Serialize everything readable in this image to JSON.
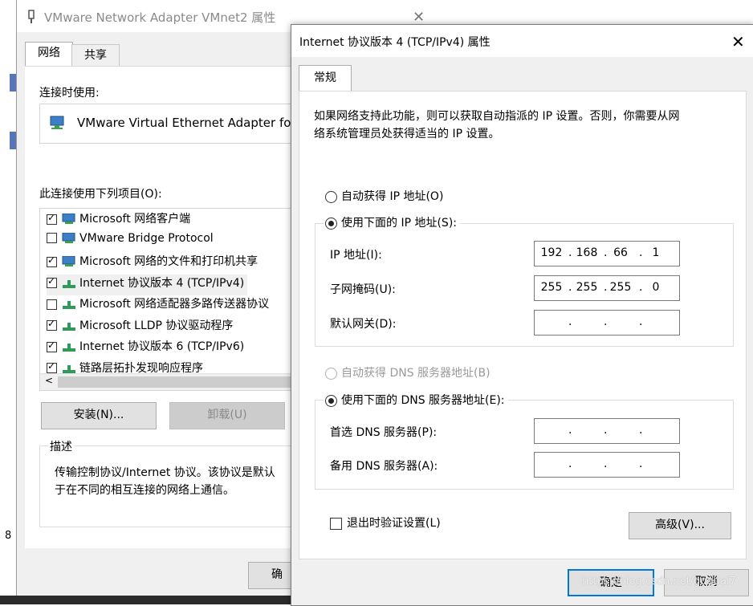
{
  "bg_window": {
    "title": "VMware Network Adapter VMnet2 属性",
    "tabs": [
      "网络",
      "共享"
    ],
    "connect_using_label": "连接时使用:",
    "adapter_name": "VMware Virtual Ethernet Adapter for",
    "items_label": "此连接使用下列项目(O):",
    "items": [
      {
        "label": "Microsoft 网络客户端",
        "checked": true,
        "icon": "network-client-icon"
      },
      {
        "label": "VMware Bridge Protocol",
        "checked": false,
        "icon": "network-client-icon"
      },
      {
        "label": "Microsoft 网络的文件和打印机共享",
        "checked": true,
        "icon": "network-client-icon"
      },
      {
        "label": "Internet 协议版本 4 (TCP/IPv4)",
        "checked": true,
        "icon": "protocol-icon"
      },
      {
        "label": "Microsoft 网络适配器多路传送器协议",
        "checked": false,
        "icon": "protocol-icon"
      },
      {
        "label": "Microsoft LLDP 协议驱动程序",
        "checked": true,
        "icon": "protocol-icon"
      },
      {
        "label": "Internet 协议版本 6 (TCP/IPv6)",
        "checked": true,
        "icon": "protocol-icon"
      },
      {
        "label": "链路层拓扑发现响应程序",
        "checked": true,
        "icon": "protocol-icon"
      }
    ],
    "install_button": "安装(N)...",
    "uninstall_button": "卸载(U)",
    "description_label": "描述",
    "description_text": "传输控制协议/Internet 协议。该协议是默认",
    "description_text2": "于在不同的相互连接的网络上通信。",
    "ok_button_partial": "确",
    "left_edge_char": "8"
  },
  "dialog": {
    "title": "Internet 协议版本 4 (TCP/IPv4) 属性",
    "tab": "常规",
    "intro_line1": "如果网络支持此功能，则可以获取自动指派的 IP 设置。否则，你需要从网",
    "intro_line2": "络系统管理员处获得适当的 IP 设置。",
    "auto_ip_label": "自动获得 IP 地址(O)",
    "manual_ip_label": "使用下面的 IP 地址(S):",
    "ip_address_label": "IP 地址(I):",
    "ip_address": [
      "192",
      "168",
      "66",
      "1"
    ],
    "subnet_label": "子网掩码(U):",
    "subnet": [
      "255",
      "255",
      "255",
      "0"
    ],
    "gateway_label": "默认网关(D):",
    "gateway": [
      "",
      "",
      "",
      ""
    ],
    "auto_dns_label": "自动获得 DNS 服务器地址(B)",
    "manual_dns_label": "使用下面的 DNS 服务器地址(E):",
    "preferred_dns_label": "首选 DNS 服务器(P):",
    "preferred_dns": [
      "",
      "",
      "",
      ""
    ],
    "alternate_dns_label": "备用 DNS 服务器(A):",
    "alternate_dns": [
      "",
      "",
      "",
      ""
    ],
    "validate_label": "退出时验证设置(L)",
    "advanced_button": "高级(V)...",
    "ok_button": "确定",
    "cancel_button": "取消",
    "ip_mode": "manual",
    "dns_mode": "manual",
    "validate_checked": false
  },
  "watermark": "https://blog.csdn.net/guguai7"
}
